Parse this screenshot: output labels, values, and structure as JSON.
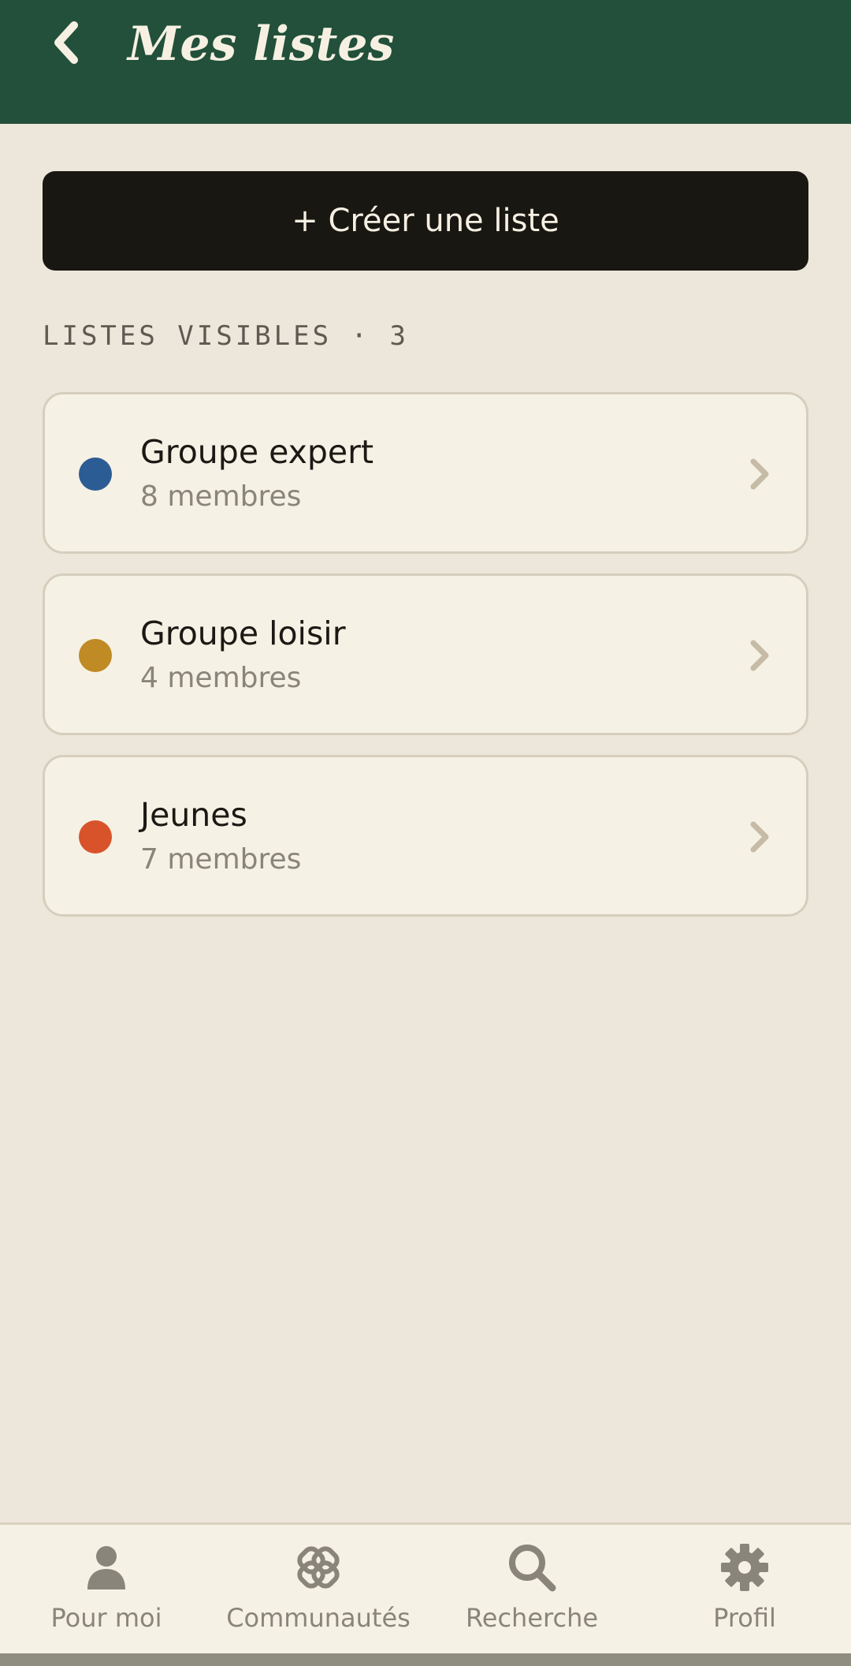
{
  "header": {
    "title": "Mes listes",
    "back_icon": "chevron-left-icon"
  },
  "create_button": {
    "label": "+ Créer une liste"
  },
  "section": {
    "label": "LISTES VISIBLES · 3"
  },
  "lists": [
    {
      "name": "Groupe expert",
      "count": "8 membres",
      "color": "#2c5c94"
    },
    {
      "name": "Groupe loisir",
      "count": "4 membres",
      "color": "#c08a24"
    },
    {
      "name": "Jeunes",
      "count": "7 membres",
      "color": "#d9532a"
    }
  ],
  "nav": {
    "items": [
      {
        "label": "Pour moi",
        "icon": "person-icon"
      },
      {
        "label": "Communautés",
        "icon": "communities-icon"
      },
      {
        "label": "Recherche",
        "icon": "search-icon"
      },
      {
        "label": "Profil",
        "icon": "gear-icon"
      }
    ]
  },
  "colors": {
    "header_bg": "#22503a",
    "page_bg": "#ede6da",
    "card_bg": "#f6f1e5",
    "button_bg": "#191712",
    "nav_icon": "#8a857b",
    "chevron": "#c5bba6"
  }
}
